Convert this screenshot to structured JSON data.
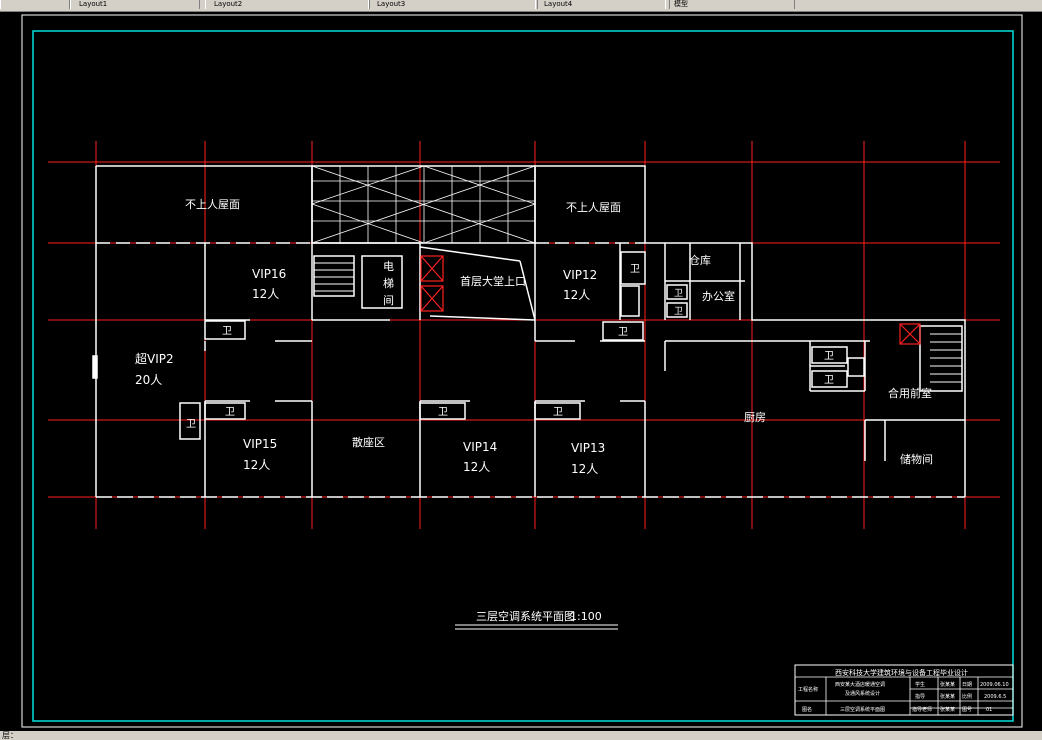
{
  "topbar": {
    "tabs": [
      "Layout1",
      "Layout2",
      "Layout3",
      "Layout4",
      "模型"
    ]
  },
  "status": {
    "text": "层："
  },
  "drawing": {
    "rooms": {
      "roof_left": "不上人屋面",
      "roof_right": "不上人屋面",
      "vip16": "VIP16",
      "vip16_cap": "12人",
      "vip12": "VIP12",
      "vip12_cap": "12人",
      "vip2": "超VIP2",
      "vip2_cap": "20人",
      "vip15": "VIP15",
      "vip15_cap": "12人",
      "vip14": "VIP14",
      "vip14_cap": "12人",
      "vip13": "VIP13",
      "vip13_cap": "12人",
      "elevator_1": "电",
      "elevator_2": "梯",
      "elevator_3": "间",
      "lobby_above": "首层大堂上口",
      "warehouse": "仓库",
      "office": "办公室",
      "dining": "散座区",
      "kitchen": "厨房",
      "shared_front": "合用前室",
      "storage": "储物间",
      "wc": "卫"
    },
    "title": "三层空调系统平面图",
    "scale": "1:100"
  },
  "title_block": {
    "school": "西安科技大学建筑环境与设备工程毕业设计",
    "project_label": "工程名称",
    "project_name_1": "西安某大酒店暖通空调",
    "project_name_2": "及通风系统设计",
    "drawing_label": "图名",
    "drawing_name": "三层空调系统平面图",
    "r1": [
      "学生",
      "张某某",
      "日期",
      "2009.06.10"
    ],
    "r2": [
      "指导",
      "张某某",
      "比例",
      "2009.6.5"
    ],
    "r3": [
      "指导老师",
      "张某某",
      "图号",
      "01"
    ]
  },
  "colors": {
    "grid": "#ff2020",
    "wall": "#ffffff",
    "frame": "#00e0e0",
    "background": "#000000"
  }
}
